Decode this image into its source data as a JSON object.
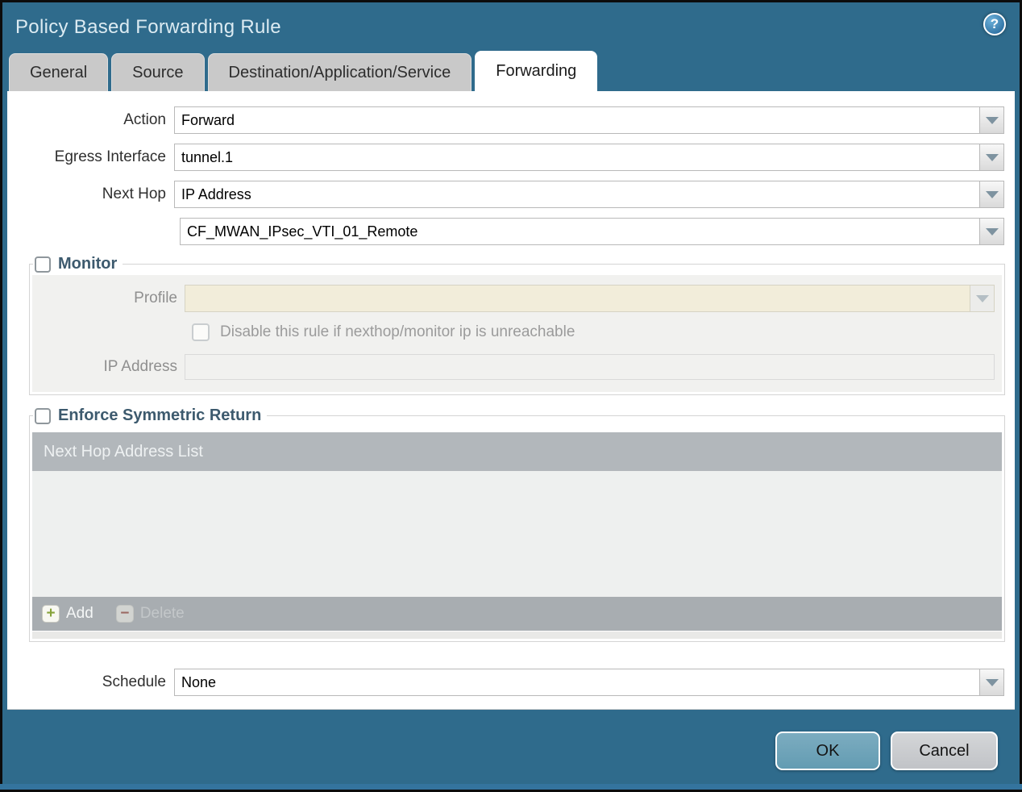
{
  "dialog": {
    "title": "Policy Based Forwarding Rule"
  },
  "tabs": [
    {
      "label": "General",
      "active": false
    },
    {
      "label": "Source",
      "active": false
    },
    {
      "label": "Destination/Application/Service",
      "active": false
    },
    {
      "label": "Forwarding",
      "active": true
    }
  ],
  "form": {
    "action": {
      "label": "Action",
      "value": "Forward"
    },
    "egress_interface": {
      "label": "Egress Interface",
      "value": "tunnel.1"
    },
    "next_hop": {
      "label": "Next Hop",
      "value": "IP Address"
    },
    "next_hop_address": {
      "value": "CF_MWAN_IPsec_VTI_01_Remote"
    },
    "schedule": {
      "label": "Schedule",
      "value": "None"
    }
  },
  "monitor": {
    "label": "Monitor",
    "checked": false,
    "profile": {
      "label": "Profile",
      "value": ""
    },
    "disable_rule": {
      "label": "Disable this rule if nexthop/monitor ip is unreachable",
      "checked": false
    },
    "ip_address": {
      "label": "IP Address",
      "value": ""
    }
  },
  "symmetric_return": {
    "label": "Enforce Symmetric Return",
    "checked": false,
    "table": {
      "header": "Next Hop Address List",
      "rows": [],
      "add_label": "Add",
      "delete_label": "Delete"
    }
  },
  "footer": {
    "ok_label": "OK",
    "cancel_label": "Cancel"
  },
  "colors": {
    "titlebar_teal": "#2f6b8c",
    "ok_button_blue": "#6ea4ba",
    "disabled_beige": "#f2edda",
    "table_header_gray": "#b2b7bb",
    "legend_text": "#3d5a6e"
  }
}
